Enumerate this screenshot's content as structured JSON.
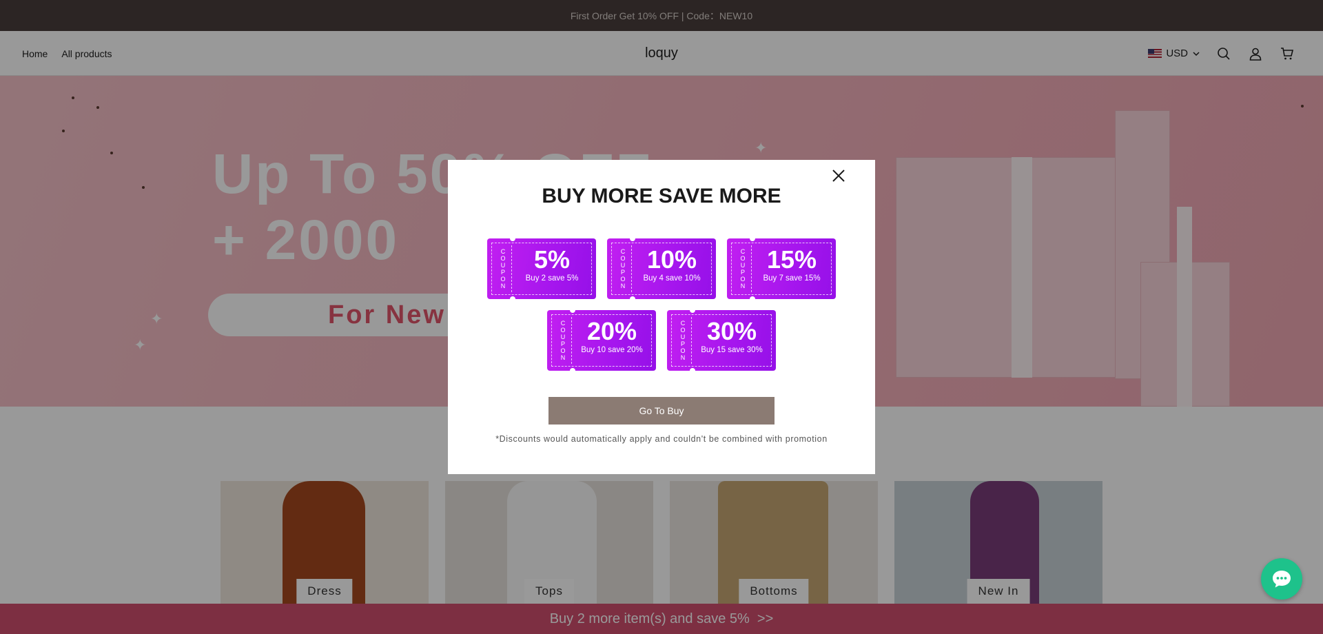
{
  "announcement": {
    "text": "First Order Get 10% OFF | Code：NEW10"
  },
  "header": {
    "nav": [
      "Home",
      "All products"
    ],
    "logo": "loquy",
    "currency": "USD",
    "icons": [
      "search-icon",
      "account-icon",
      "cart-icon"
    ]
  },
  "hero": {
    "line1": "Up To 50% OFF",
    "line2": "+ 2000",
    "pill": "For New"
  },
  "categories": [
    {
      "label": "Dress"
    },
    {
      "label": "Tops"
    },
    {
      "label": "Bottoms"
    },
    {
      "label": "New In"
    }
  ],
  "modal": {
    "title": "BUY MORE SAVE MORE",
    "coupon_stub": "COUPON",
    "coupons": [
      {
        "pct": "5%",
        "desc": "Buy 2 save 5%"
      },
      {
        "pct": "10%",
        "desc": "Buy 4 save 10%"
      },
      {
        "pct": "15%",
        "desc": "Buy 7 save 15%"
      },
      {
        "pct": "20%",
        "desc": "Buy 10 save 20%"
      },
      {
        "pct": "30%",
        "desc": "Buy 15 save 30%"
      }
    ],
    "button": "Go To Buy",
    "note": "*Discounts would automatically apply and couldn't be combined with promotion"
  },
  "sticky_bar": {
    "text": "Buy 2 more item(s) and save 5%  >>"
  },
  "colors": {
    "announcement_bg": "#4a3e3c",
    "coupon": "#b01aef",
    "go_button": "#8b7b73",
    "sticky_bar": "#d04f6e",
    "chat": "#1ec28b"
  }
}
